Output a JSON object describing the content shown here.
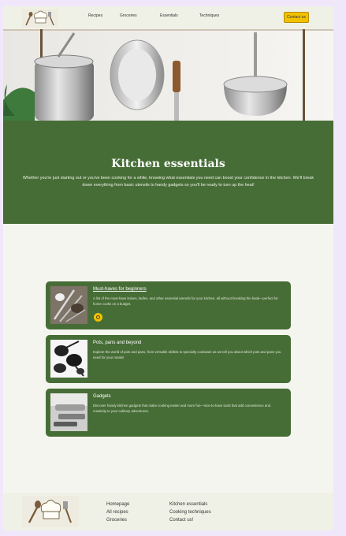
{
  "header": {
    "nav": [
      "Recipes",
      "Groceries",
      "Essentials",
      "Techniques"
    ],
    "contact_label": "Contact us"
  },
  "hero": {
    "image": "hanging-pots-and-pans"
  },
  "intro": {
    "title": "Kitchen essentials",
    "text": "Whether you're just starting out or you've been cooking for a while, knowing what essentials you need can boost your confidence in the kitchen. We'll break down everything from basic utensils to handy gadgets so you'll be ready to turn up the heat!"
  },
  "cards": [
    {
      "title": "Must-haves for beginners",
      "desc": "A list of the must-have knives, ladles, and other essential utensils for your kitchen, all without breaking the bank—perfect for home cooks on a budget.",
      "image": "utensils-photo"
    },
    {
      "title": "Pots, pans and beyond",
      "desc": "Explore the world of pots and pans, from versatile skillets to specialty cookware as we tell you about which pots and pans you need for your meals!",
      "image": "pans-photo"
    },
    {
      "title": "Gadgets",
      "desc": "Discover handy kitchen gadgets that make cooking easier and more fun—nice-to-have tools that add convenience and creativity to your culinary adventures.",
      "image": "gadgets-photo"
    }
  ],
  "footer": {
    "col1": [
      "Homepage",
      "All recipes",
      "Groceries"
    ],
    "col2": [
      "Kitchen essentials",
      "Cooking techniques",
      "Contact us!"
    ]
  }
}
